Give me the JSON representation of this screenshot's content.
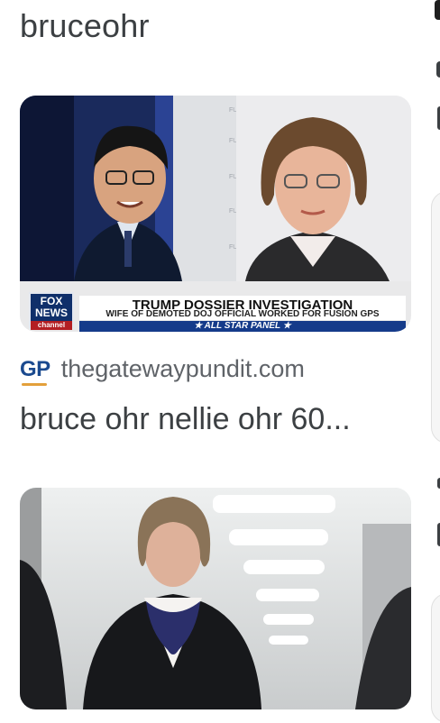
{
  "search": {
    "query": "bruceohr"
  },
  "result1": {
    "image_alt": "Fox News split-screen of Bruce Ohr and Nellie Ohr",
    "chyron": {
      "network_line1": "FOX",
      "network_line2": "NEWS",
      "network_line3": "channel",
      "headline": "TRUMP DOSSIER INVESTIGATION",
      "subline": "WIFE OF DEMOTED DOJ OFFICIAL WORKED FOR FUSION GPS",
      "panel": "★ ALL STAR PANEL ★"
    },
    "source": {
      "logo": "GP",
      "name": "thegatewaypundit.com"
    },
    "title": "bruce ohr nellie ohr 60..."
  },
  "result2": {
    "image_alt": "Woman in dark coat walking in hallway"
  },
  "colors": {
    "fox_blue": "#0f2f6a",
    "fox_red": "#b31e22",
    "gp_blue": "#1b4a8f",
    "gp_gold": "#e3a03b"
  }
}
